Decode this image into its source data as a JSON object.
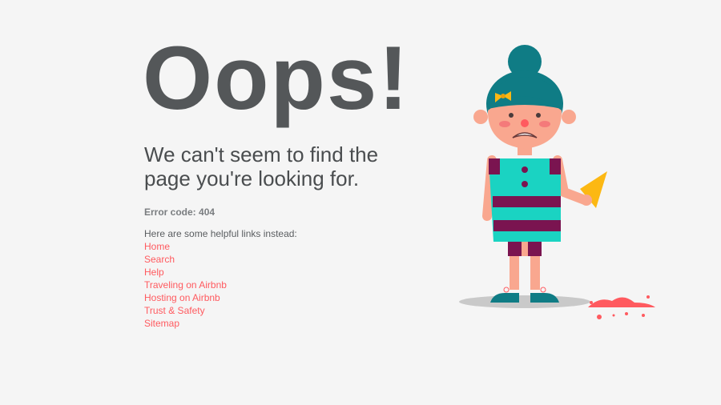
{
  "headline": "Oops!",
  "subhead": "We can't seem to find the page you're looking for.",
  "error_code": "Error code: 404",
  "links_intro": "Here are some helpful links instead:",
  "links": [
    {
      "label": "Home"
    },
    {
      "label": "Search"
    },
    {
      "label": "Help"
    },
    {
      "label": "Traveling on Airbnb"
    },
    {
      "label": "Hosting on Airbnb"
    },
    {
      "label": "Trust & Safety"
    },
    {
      "label": "Sitemap"
    }
  ],
  "colors": {
    "background": "#f5f5f5",
    "headline": "#545759",
    "link": "#ff5a5f",
    "hair": "#0f7c85",
    "skin": "#f9a78f",
    "dress": "#1ad3c2",
    "stripe": "#7a1450",
    "ice_cream": "#ff5a5f",
    "cone": "#fcb813"
  },
  "illustration": {
    "icon": "sad-girl-dropped-ice-cream-icon"
  }
}
